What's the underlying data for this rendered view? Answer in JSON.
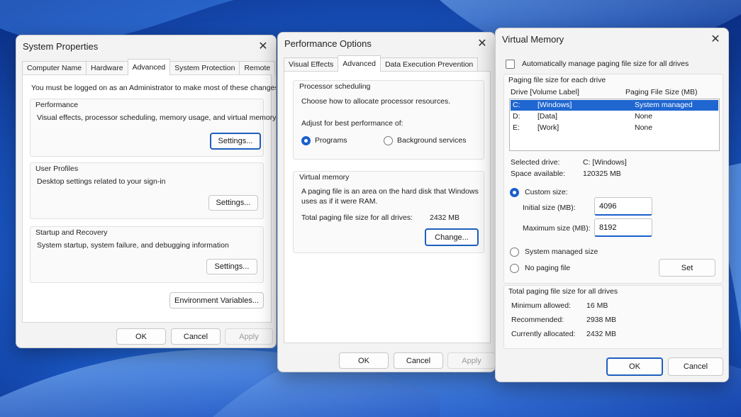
{
  "system_properties": {
    "title": "System Properties",
    "tabs": [
      "Computer Name",
      "Hardware",
      "Advanced",
      "System Protection",
      "Remote"
    ],
    "active_tab": "Advanced",
    "admin_note": "You must be logged on as an Administrator to make most of these changes.",
    "performance": {
      "title": "Performance",
      "desc": "Visual effects, processor scheduling, memory usage, and virtual memory",
      "button": "Settings..."
    },
    "user_profiles": {
      "title": "User Profiles",
      "desc": "Desktop settings related to your sign-in",
      "button": "Settings..."
    },
    "startup_recovery": {
      "title": "Startup and Recovery",
      "desc": "System startup, system failure, and debugging information",
      "button": "Settings..."
    },
    "env_button": "Environment Variables...",
    "ok": "OK",
    "cancel": "Cancel",
    "apply": "Apply"
  },
  "performance_options": {
    "title": "Performance Options",
    "tabs": [
      "Visual Effects",
      "Advanced",
      "Data Execution Prevention"
    ],
    "active_tab": "Advanced",
    "processor": {
      "title": "Processor scheduling",
      "desc": "Choose how to allocate processor resources.",
      "adjust": "Adjust for best performance of:",
      "programs": "Programs",
      "background": "Background services",
      "selected": "Programs"
    },
    "virtual_memory": {
      "title": "Virtual memory",
      "desc1": "A paging file is an area on the hard disk that Windows",
      "desc2": "uses as if it were RAM.",
      "total_label": "Total paging file size for all drives:",
      "total_value": "2432 MB",
      "button": "Change..."
    },
    "ok": "OK",
    "cancel": "Cancel",
    "apply": "Apply"
  },
  "virtual_memory": {
    "title": "Virtual Memory",
    "auto_manage": "Automatically manage paging file size for all drives",
    "auto_checked": false,
    "paging_title": "Paging file size for each drive",
    "col_drive": "Drive  [Volume Label]",
    "col_size": "Paging File Size (MB)",
    "drives": [
      {
        "drive": "C:",
        "label": "[Windows]",
        "size": "System managed"
      },
      {
        "drive": "D:",
        "label": "[Data]",
        "size": "None"
      },
      {
        "drive": "E:",
        "label": "[Work]",
        "size": "None"
      }
    ],
    "selected_drive_label": "Selected drive:",
    "selected_drive_value": "C:  [Windows]",
    "space_label": "Space available:",
    "space_value": "120325 MB",
    "custom_size": "Custom size:",
    "initial_label": "Initial size (MB):",
    "initial_value": "4096",
    "max_label": "Maximum size (MB):",
    "max_value": "8192",
    "system_managed": "System managed size",
    "no_paging": "No paging file",
    "selected_option": "Custom size",
    "set_button": "Set",
    "total_title": "Total paging file size for all drives",
    "min_label": "Minimum allowed:",
    "min_value": "16 MB",
    "rec_label": "Recommended:",
    "rec_value": "2938 MB",
    "cur_label": "Currently allocated:",
    "cur_value": "2432 MB",
    "ok": "OK",
    "cancel": "Cancel"
  },
  "colors": {
    "accent": "#1f5fbf",
    "selection": "#1f66d1",
    "wallpaper": "#1e63c9"
  }
}
